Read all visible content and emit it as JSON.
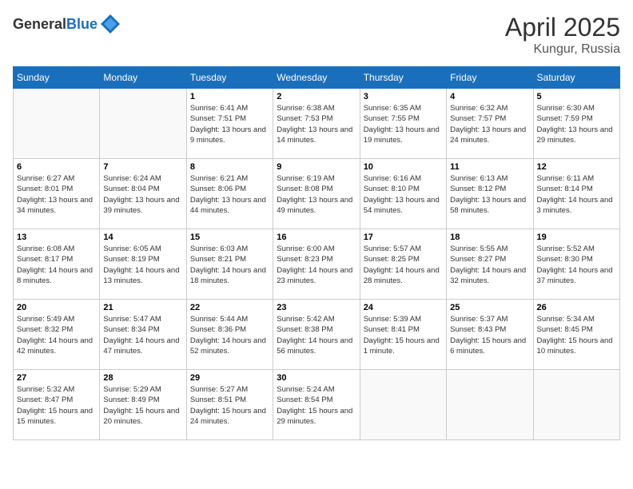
{
  "header": {
    "logo_general": "General",
    "logo_blue": "Blue",
    "month": "April 2025",
    "location": "Kungur, Russia"
  },
  "weekdays": [
    "Sunday",
    "Monday",
    "Tuesday",
    "Wednesday",
    "Thursday",
    "Friday",
    "Saturday"
  ],
  "weeks": [
    [
      {
        "day": "",
        "info": ""
      },
      {
        "day": "",
        "info": ""
      },
      {
        "day": "1",
        "info": "Sunrise: 6:41 AM\nSunset: 7:51 PM\nDaylight: 13 hours and 9 minutes."
      },
      {
        "day": "2",
        "info": "Sunrise: 6:38 AM\nSunset: 7:53 PM\nDaylight: 13 hours and 14 minutes."
      },
      {
        "day": "3",
        "info": "Sunrise: 6:35 AM\nSunset: 7:55 PM\nDaylight: 13 hours and 19 minutes."
      },
      {
        "day": "4",
        "info": "Sunrise: 6:32 AM\nSunset: 7:57 PM\nDaylight: 13 hours and 24 minutes."
      },
      {
        "day": "5",
        "info": "Sunrise: 6:30 AM\nSunset: 7:59 PM\nDaylight: 13 hours and 29 minutes."
      }
    ],
    [
      {
        "day": "6",
        "info": "Sunrise: 6:27 AM\nSunset: 8:01 PM\nDaylight: 13 hours and 34 minutes."
      },
      {
        "day": "7",
        "info": "Sunrise: 6:24 AM\nSunset: 8:04 PM\nDaylight: 13 hours and 39 minutes."
      },
      {
        "day": "8",
        "info": "Sunrise: 6:21 AM\nSunset: 8:06 PM\nDaylight: 13 hours and 44 minutes."
      },
      {
        "day": "9",
        "info": "Sunrise: 6:19 AM\nSunset: 8:08 PM\nDaylight: 13 hours and 49 minutes."
      },
      {
        "day": "10",
        "info": "Sunrise: 6:16 AM\nSunset: 8:10 PM\nDaylight: 13 hours and 54 minutes."
      },
      {
        "day": "11",
        "info": "Sunrise: 6:13 AM\nSunset: 8:12 PM\nDaylight: 13 hours and 58 minutes."
      },
      {
        "day": "12",
        "info": "Sunrise: 6:11 AM\nSunset: 8:14 PM\nDaylight: 14 hours and 3 minutes."
      }
    ],
    [
      {
        "day": "13",
        "info": "Sunrise: 6:08 AM\nSunset: 8:17 PM\nDaylight: 14 hours and 8 minutes."
      },
      {
        "day": "14",
        "info": "Sunrise: 6:05 AM\nSunset: 8:19 PM\nDaylight: 14 hours and 13 minutes."
      },
      {
        "day": "15",
        "info": "Sunrise: 6:03 AM\nSunset: 8:21 PM\nDaylight: 14 hours and 18 minutes."
      },
      {
        "day": "16",
        "info": "Sunrise: 6:00 AM\nSunset: 8:23 PM\nDaylight: 14 hours and 23 minutes."
      },
      {
        "day": "17",
        "info": "Sunrise: 5:57 AM\nSunset: 8:25 PM\nDaylight: 14 hours and 28 minutes."
      },
      {
        "day": "18",
        "info": "Sunrise: 5:55 AM\nSunset: 8:27 PM\nDaylight: 14 hours and 32 minutes."
      },
      {
        "day": "19",
        "info": "Sunrise: 5:52 AM\nSunset: 8:30 PM\nDaylight: 14 hours and 37 minutes."
      }
    ],
    [
      {
        "day": "20",
        "info": "Sunrise: 5:49 AM\nSunset: 8:32 PM\nDaylight: 14 hours and 42 minutes."
      },
      {
        "day": "21",
        "info": "Sunrise: 5:47 AM\nSunset: 8:34 PM\nDaylight: 14 hours and 47 minutes."
      },
      {
        "day": "22",
        "info": "Sunrise: 5:44 AM\nSunset: 8:36 PM\nDaylight: 14 hours and 52 minutes."
      },
      {
        "day": "23",
        "info": "Sunrise: 5:42 AM\nSunset: 8:38 PM\nDaylight: 14 hours and 56 minutes."
      },
      {
        "day": "24",
        "info": "Sunrise: 5:39 AM\nSunset: 8:41 PM\nDaylight: 15 hours and 1 minute."
      },
      {
        "day": "25",
        "info": "Sunrise: 5:37 AM\nSunset: 8:43 PM\nDaylight: 15 hours and 6 minutes."
      },
      {
        "day": "26",
        "info": "Sunrise: 5:34 AM\nSunset: 8:45 PM\nDaylight: 15 hours and 10 minutes."
      }
    ],
    [
      {
        "day": "27",
        "info": "Sunrise: 5:32 AM\nSunset: 8:47 PM\nDaylight: 15 hours and 15 minutes."
      },
      {
        "day": "28",
        "info": "Sunrise: 5:29 AM\nSunset: 8:49 PM\nDaylight: 15 hours and 20 minutes."
      },
      {
        "day": "29",
        "info": "Sunrise: 5:27 AM\nSunset: 8:51 PM\nDaylight: 15 hours and 24 minutes."
      },
      {
        "day": "30",
        "info": "Sunrise: 5:24 AM\nSunset: 8:54 PM\nDaylight: 15 hours and 29 minutes."
      },
      {
        "day": "",
        "info": ""
      },
      {
        "day": "",
        "info": ""
      },
      {
        "day": "",
        "info": ""
      }
    ]
  ]
}
